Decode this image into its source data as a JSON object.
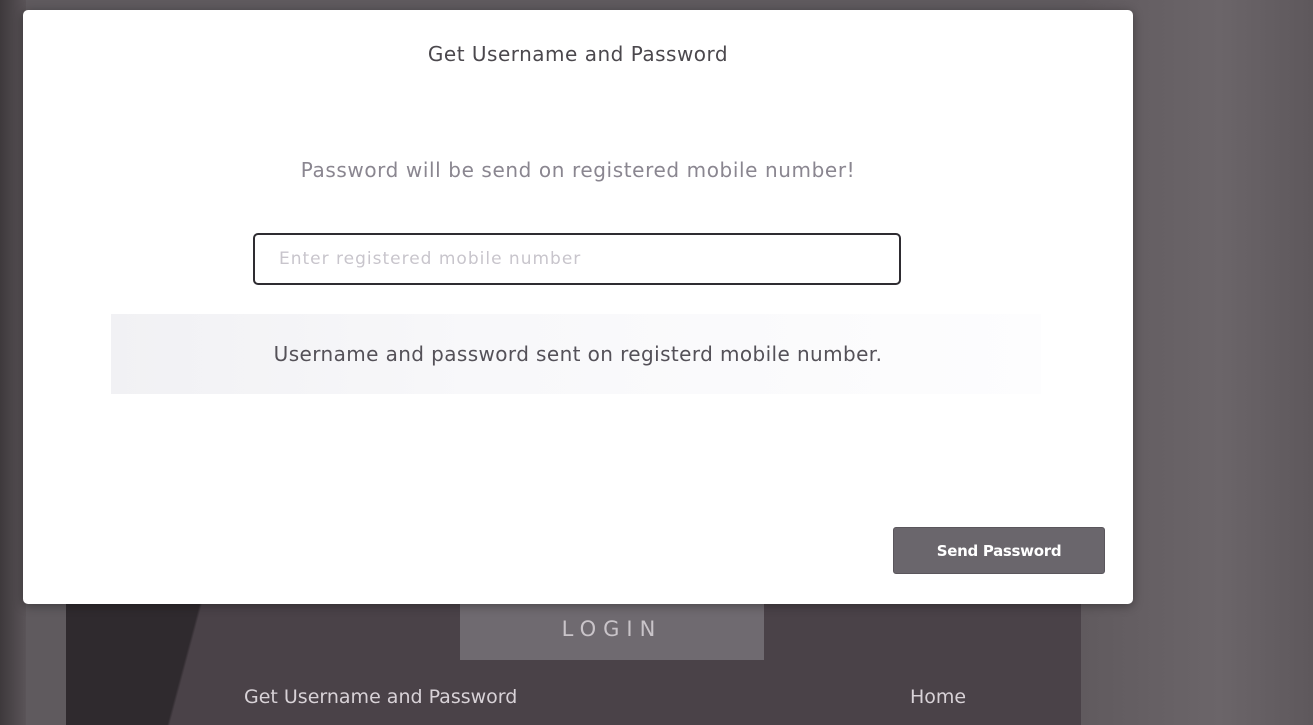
{
  "modal": {
    "title": "Get Username and Password",
    "info_text": "Password will be send on registered mobile number!",
    "mobile_input": {
      "value": "",
      "placeholder": "Enter registered mobile number"
    },
    "success_message": "Username and password sent on registerd mobile number.",
    "send_button_label": "Send Password"
  },
  "background": {
    "login_button_label": "LOGIN",
    "links": {
      "get_credentials": "Get Username and Password",
      "home": "Home"
    }
  },
  "colors": {
    "overlay": "#5f5a5e",
    "modal_bg": "#ffffff",
    "button_bg": "#6a666c",
    "input_border": "#2e2c31"
  }
}
